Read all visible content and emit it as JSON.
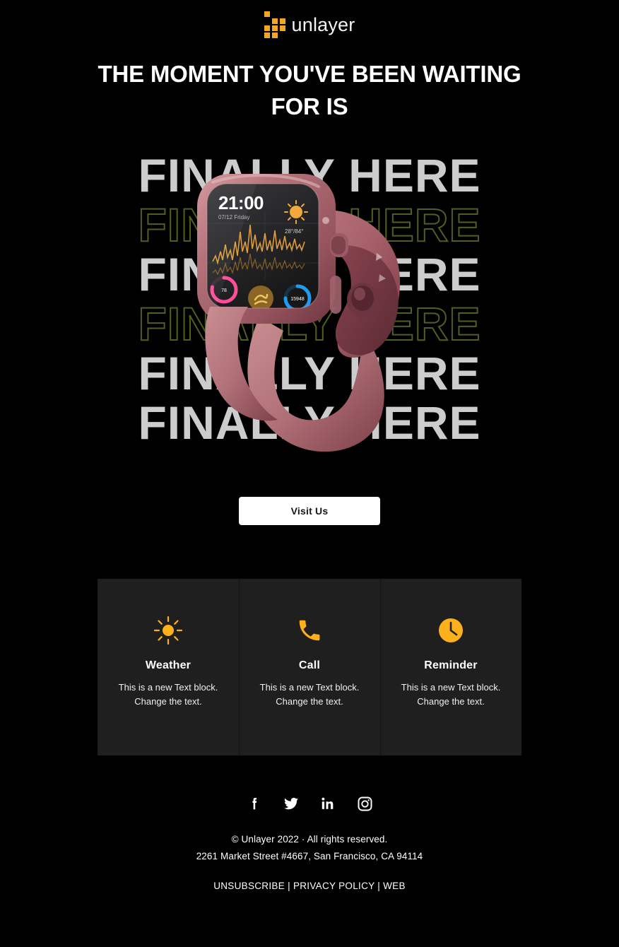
{
  "brand": {
    "logo_icon": "unlayer-squares-logo-icon",
    "name": "unlayer",
    "accent_color": "#f5a623"
  },
  "headline": {
    "text": "THE MOMENT YOU'VE BEEN WAITING FOR IS"
  },
  "hero": {
    "repeat_text": "FINALLY HERE",
    "rows": [
      {
        "text": "FINALLY HERE",
        "style": "solid"
      },
      {
        "text": "FINALLY HERE",
        "style": "outline"
      },
      {
        "text": "FINALLY HERE",
        "style": "solid"
      },
      {
        "text": "FINALLY HERE",
        "style": "outline"
      },
      {
        "text": "FINALLY HERE",
        "style": "solid"
      },
      {
        "text": "FINALLY HERE",
        "style": "solid"
      }
    ],
    "solid_color": "#cccccc",
    "outline_color": "#4f5f22",
    "product_image": "smartwatch-rose-gold-image",
    "watch_face": {
      "time": "21:00",
      "date": "07/12 Friday",
      "weather_icon": "sun-icon",
      "temperature": "28°/84°",
      "chart_color": "#e8a33d",
      "widget_rings": [
        {
          "name": "activity-ring",
          "value": "78",
          "color": "#ff4d97"
        },
        {
          "name": "exercise-ring",
          "value": "",
          "color": "#e8a33d"
        },
        {
          "name": "steps-ring",
          "value": "15948",
          "color": "#1f9cf0"
        }
      ]
    }
  },
  "cta": {
    "label": "Visit Us"
  },
  "features": {
    "background": "#1f1f1f",
    "items": [
      {
        "icon": "sun-icon",
        "title": "Weather",
        "line1": "This is a new Text block.",
        "line2": "Change the text."
      },
      {
        "icon": "phone-icon",
        "title": "Call",
        "line1": "This is a new Text block.",
        "line2": "Change the text."
      },
      {
        "icon": "clock-icon",
        "title": "Reminder",
        "line1": "This is a new Text block.",
        "line2": "Change the text."
      }
    ]
  },
  "footer": {
    "social": [
      {
        "icon": "facebook-icon",
        "name": "Facebook"
      },
      {
        "icon": "twitter-icon",
        "name": "Twitter"
      },
      {
        "icon": "linkedin-icon",
        "name": "LinkedIn"
      },
      {
        "icon": "instagram-icon",
        "name": "Instagram"
      }
    ],
    "copyright": "© Unlayer 2022 · All rights reserved.",
    "address": "2261 Market Street #4667, San Francisco, CA 94114",
    "links": {
      "unsubscribe": "UNSUBSCRIBE",
      "privacy": "PRIVACY POLICY",
      "web": "WEB",
      "separator": "|"
    }
  }
}
